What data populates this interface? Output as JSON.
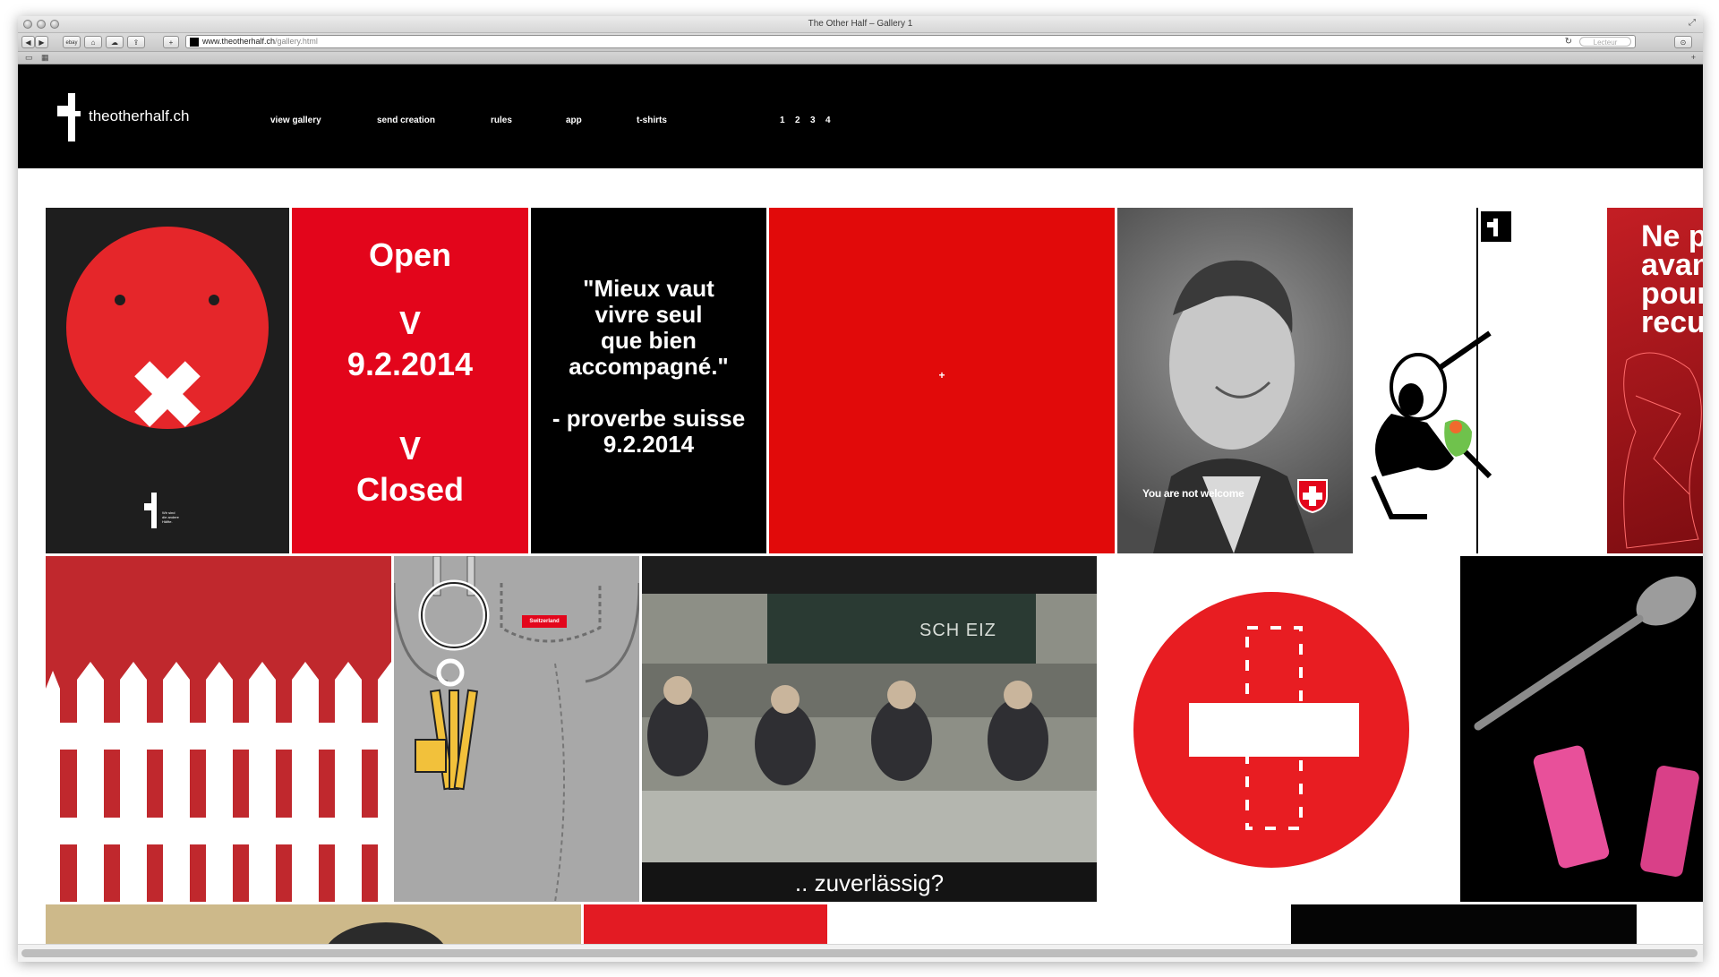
{
  "browser": {
    "title": "The Other Half – Gallery 1",
    "url_host": "www.theotherhalf.ch",
    "url_path": "/gallery.html",
    "reader_label": "Lecteur",
    "toolbar_buttons": [
      "◀",
      "▶",
      "ebay",
      "⌂",
      "☁",
      "⇪",
      "+"
    ]
  },
  "site": {
    "logo_text": "theotherhalf.ch",
    "nav": [
      "view gallery",
      "send creation",
      "rules",
      "app",
      "t-shirts"
    ],
    "pages": [
      "1",
      "2",
      "3",
      "4"
    ]
  },
  "gallery": {
    "open_closed": {
      "open": "Open",
      "v1": "V",
      "date": "9.2.2014",
      "v2": "V",
      "closed": "Closed"
    },
    "proverb": {
      "line1": "\"Mieux vaut",
      "line2": "vivre seul",
      "line3": "que bien",
      "line4": "accompagné.\"",
      "line5": "- proverbe suisse",
      "line6": "9.2.2014"
    },
    "small_logo_lines": [
      "Wir sind",
      "die andere",
      "Hälfte."
    ],
    "red_plus": "+",
    "portrait_caption": "You are not welcome",
    "partial_poster": [
      "Ne p",
      "avan",
      "pour",
      "recu"
    ],
    "jeans_tag": "Switzerland",
    "classroom_board": "SCH EIZ",
    "classroom_subtitle": ".. zuverlässig?"
  }
}
